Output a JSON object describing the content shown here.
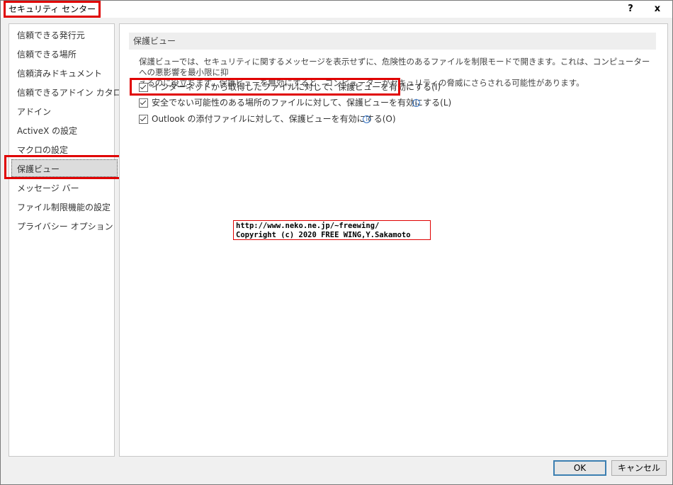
{
  "window": {
    "title": "セキュリティ センター",
    "help_label": "?",
    "close_label": "x"
  },
  "sidebar": {
    "items": [
      {
        "label": "信頼できる発行元"
      },
      {
        "label": "信頼できる場所"
      },
      {
        "label": "信頼済みドキュメント"
      },
      {
        "label": "信頼できるアドイン カタログ"
      },
      {
        "label": "アドイン"
      },
      {
        "label": "ActiveX の設定"
      },
      {
        "label": "マクロの設定"
      },
      {
        "label": "保護ビュー",
        "selected": true
      },
      {
        "label": "メッセージ バー"
      },
      {
        "label": "ファイル制限機能の設定"
      },
      {
        "label": "プライバシー オプション"
      }
    ]
  },
  "main": {
    "section_title": "保護ビュー",
    "description_line1": "保護ビューでは、セキュリティに関するメッセージを表示せずに、危険性のあるファイルを制限モードで開きます。これは、コンピューターへの悪影響を最小限に抑",
    "description_line2": "えるのに役立ちます。保護ビューを無効にすると、コンピューターがセキュリティの脅威にさらされる可能性があります。",
    "options": [
      {
        "label": "インターネットから取得したファイルに対して、保護ビューを有効にする(I)",
        "checked": true,
        "info_icon": false
      },
      {
        "label": "安全でない可能性のある場所のファイルに対して、保護ビューを有効にする(L)",
        "checked": true,
        "info_icon": true
      },
      {
        "label": "Outlook の添付ファイルに対して、保護ビューを有効にする(O)",
        "checked": true,
        "info_icon": true
      }
    ]
  },
  "watermark": {
    "line1": "http://www.neko.ne.jp/~freewing/",
    "line2": "Copyright (c) 2020 FREE WING,Y.Sakamoto"
  },
  "buttons": {
    "ok_label": "OK",
    "cancel_label": "キャンセル"
  },
  "colors": {
    "highlight": "#e00000",
    "accent": "#3c7fb1"
  }
}
